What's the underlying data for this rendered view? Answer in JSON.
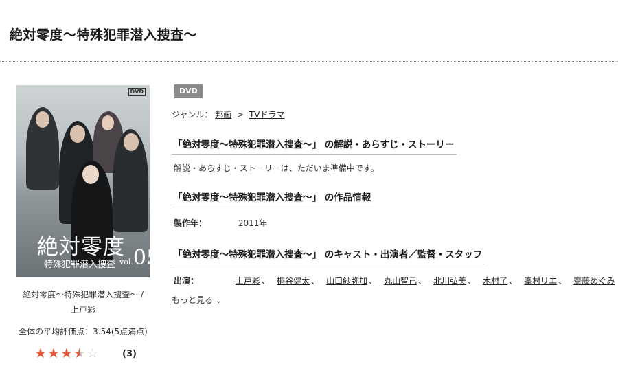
{
  "page": {
    "title": "絶対零度〜特殊犯罪潜入捜査〜"
  },
  "product": {
    "cover_alt": "絶対零度 特殊犯罪潜入捜査 vol.05 DVD cover",
    "cover_title": "絶対零度",
    "cover_subtitle": "特殊犯罪潜入捜査",
    "cover_vol_prefix": "vol.",
    "cover_vol_number": "05",
    "cover_dvd_logo": "DVD",
    "caption_title": "絶対零度〜特殊犯罪潜入捜査〜 /",
    "caption_actor": "上戸彩",
    "avg_rating_text": "全体の平均評価点：3.54(5点満点)",
    "rating_value": 3.54,
    "rating_max": 5,
    "review_count": "(3)"
  },
  "badge": "DVD",
  "genre": {
    "label": "ジャンル：",
    "crumbs": [
      "邦画",
      "TVドラマ"
    ],
    "separator": ">"
  },
  "sections": {
    "story_heading": "「絶対零度〜特殊犯罪潜入捜査〜」 の解説・あらすじ・ストーリー",
    "story_text": "解説・あらすじ・ストーリーは、ただいま準備中です。",
    "info_heading": "「絶対零度〜特殊犯罪潜入捜査〜」 の作品情報",
    "info": {
      "year_label": "製作年：",
      "year_value": "2011年"
    },
    "cast_heading": "「絶対零度〜特殊犯罪潜入捜査〜」 のキャスト・出演者／監督・スタッフ",
    "cast_label": "出演：",
    "cast": [
      "上戸彩",
      "桐谷健太",
      "山口紗弥加",
      "丸山智己",
      "北川弘美",
      "木村了",
      "峯村リエ",
      "齋藤めぐみ"
    ],
    "more_label": "もっと見る"
  },
  "colors": {
    "star": "#e8593b",
    "badge_bg": "#8c8c8c"
  }
}
